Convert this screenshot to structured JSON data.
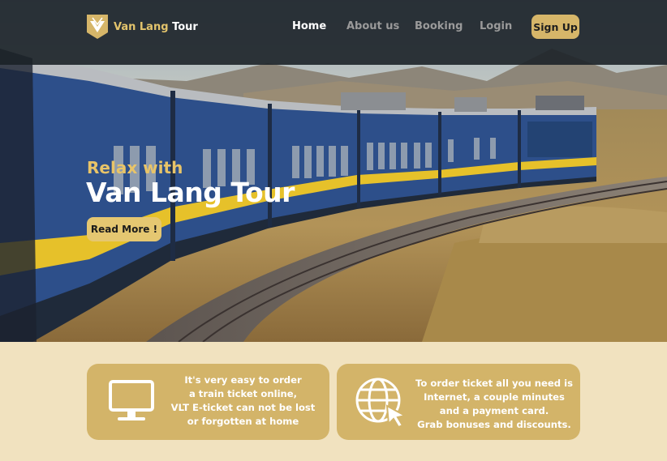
{
  "brand": {
    "name_part1": "Van Lang",
    "name_part2": "Tour"
  },
  "nav": {
    "home": "Home",
    "about": "About us",
    "booking": "Booking",
    "login": "Login",
    "signup": "Sign Up"
  },
  "hero": {
    "subtitle": "Relax with",
    "title": "Van Lang Tour",
    "cta": "Read More !"
  },
  "features": [
    {
      "icon": "monitor-icon",
      "lines": [
        "It's very easy to order",
        "a train ticket online,",
        "VLT E-ticket can not be lost",
        "or forgotten at home"
      ]
    },
    {
      "icon": "globe-cursor-icon",
      "lines": [
        "To order ticket all you need is",
        "Internet, a couple minutes",
        "and a payment card.",
        "Grab bonuses and discounts."
      ]
    }
  ],
  "colors": {
    "accent_gold": "#d6b669",
    "card_gold": "#d3b469",
    "page_background": "#f1e2bf",
    "navbar": "#1c2228",
    "train_blue": "#2d4f8a",
    "train_stripe": "#e6c12a"
  }
}
